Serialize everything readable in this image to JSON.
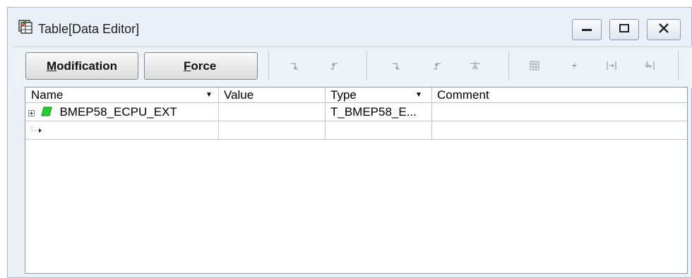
{
  "window": {
    "title": "Table[Data Editor]",
    "controls": [
      "minimize-icon",
      "restore-icon",
      "close-icon"
    ]
  },
  "toolbar": {
    "modification_label": "Modification",
    "modification_accel": "M",
    "modification_rest": "odification",
    "force_accel": "F",
    "force_rest": "orce",
    "icons": [
      "set-falling-edge-icon",
      "set-rising-edge-icon",
      "falling-edge-icon",
      "rising-edge-icon",
      "toggle-edge-icon",
      "table-grid-icon",
      "force-lightning-icon",
      "unforce-bracket-icon",
      "force-bracket-icon"
    ]
  },
  "table": {
    "columns": [
      {
        "label": "Name",
        "dropdown": true
      },
      {
        "label": "Value",
        "dropdown": false
      },
      {
        "label": "Type",
        "dropdown": true
      },
      {
        "label": "Comment",
        "dropdown": false
      }
    ],
    "rows": [
      {
        "name": "BMEP58_ECPU_EXT",
        "value": "",
        "type": "T_BMEP58_E...",
        "comment": "",
        "expandable": true,
        "icon": "green-variable-icon"
      },
      {
        "name": "",
        "value": "",
        "type": "",
        "comment": "",
        "expandable": false,
        "icon": "new-row-arrow-icon"
      }
    ]
  },
  "colors": {
    "window_bg": "#eaf0f7",
    "variable_green": "#22d12a",
    "grid_border": "#8f98a3"
  }
}
